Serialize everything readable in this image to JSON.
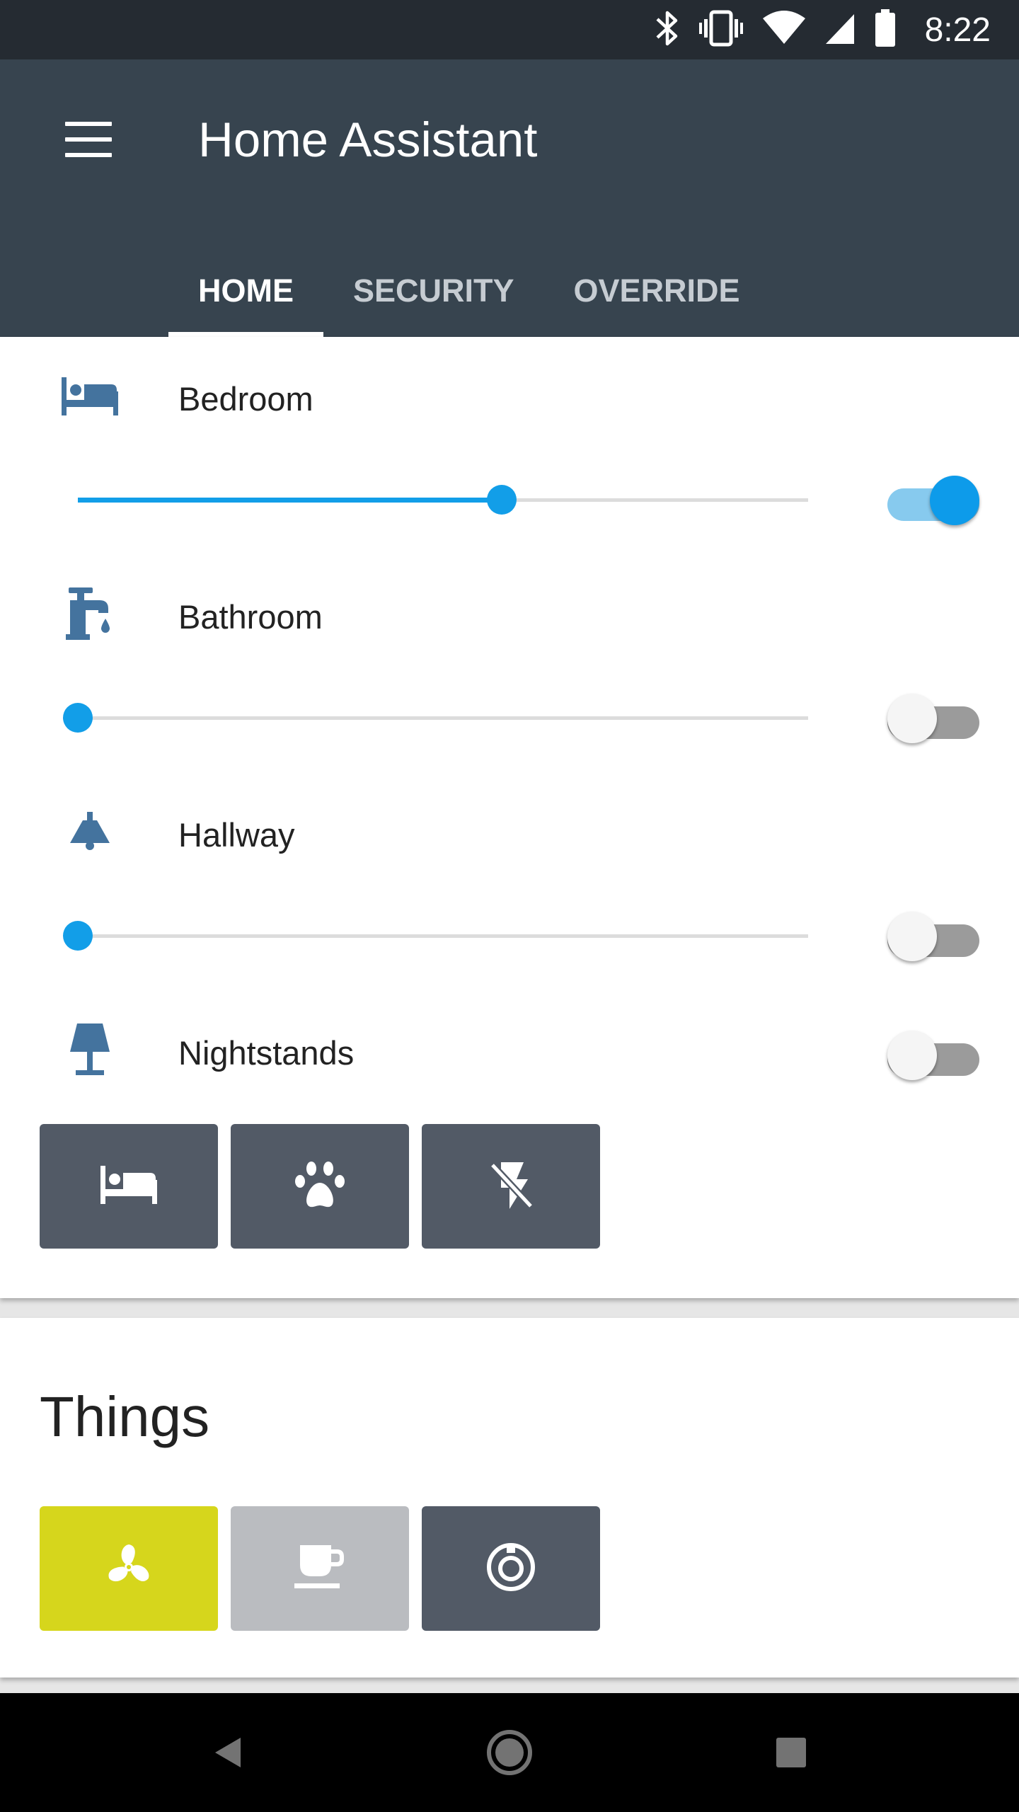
{
  "status_bar": {
    "time": "8:22",
    "icons": [
      "bluetooth-icon",
      "vibrate-icon",
      "wifi-icon",
      "signal-icon",
      "battery-icon"
    ]
  },
  "app_bar": {
    "title": "Home Assistant",
    "menu_icon": "menu-icon",
    "tabs": [
      {
        "label": "HOME",
        "active": true
      },
      {
        "label": "SECURITY",
        "active": false
      },
      {
        "label": "OVERRIDE",
        "active": false
      }
    ]
  },
  "lights": [
    {
      "label": "Bedroom",
      "icon": "bed-icon",
      "brightness_percent": 58,
      "on": true
    },
    {
      "label": "Bathroom",
      "icon": "faucet-icon",
      "brightness_percent": 0,
      "on": false
    },
    {
      "label": "Hallway",
      "icon": "ceiling-lamp-icon",
      "brightness_percent": 0,
      "on": false
    },
    {
      "label": "Nightstands",
      "icon": "table-lamp-icon",
      "on": false
    }
  ],
  "scenes": [
    {
      "icon": "bed-icon"
    },
    {
      "icon": "paw-icon"
    },
    {
      "icon": "flash-off-icon"
    }
  ],
  "things": {
    "title": "Things",
    "items": [
      {
        "icon": "fan-icon",
        "state": "on",
        "color": "#d6d61c"
      },
      {
        "icon": "coffee-maker-icon",
        "state": "unavailable",
        "color": "#babcc0"
      },
      {
        "icon": "robot-vacuum-icon",
        "state": "off",
        "color": "#525a66"
      }
    ]
  },
  "colors": {
    "status_bar": "#252b32",
    "app_bar": "#37444f",
    "accent": "#129ee8",
    "icon_blue": "#44739e",
    "scene_button": "#525a66"
  },
  "nav_bar": [
    "back-icon",
    "home-icon",
    "recents-icon"
  ]
}
